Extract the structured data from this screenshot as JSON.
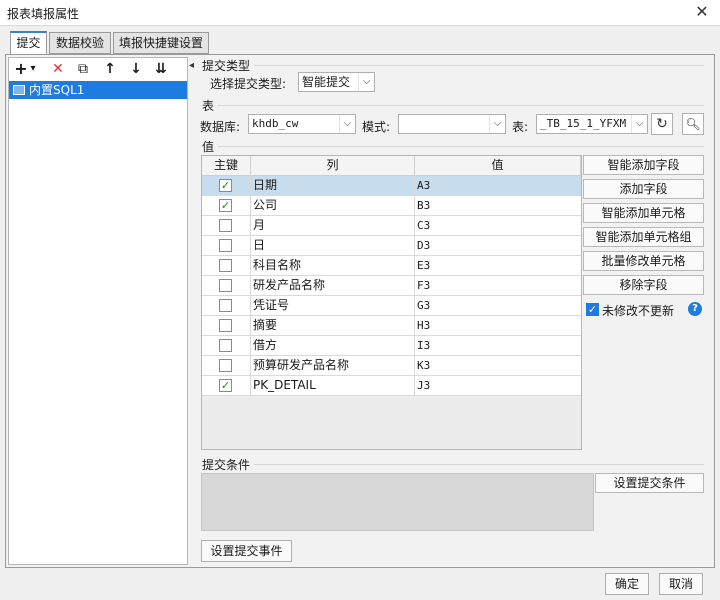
{
  "window": {
    "title": "报表填报属性",
    "close_icon": "close-icon"
  },
  "tabs": [
    {
      "label": "提交",
      "active": true
    },
    {
      "label": "数据校验",
      "active": false
    },
    {
      "label": "填报快捷键设置",
      "active": false
    }
  ],
  "toolbar": {
    "add": "+",
    "add_dropdown": "▾",
    "delete": "✕",
    "copy": "⧉",
    "move_up": "↑",
    "move_down": "↓",
    "sort": "⇊"
  },
  "tree": {
    "items": [
      {
        "label": "内置SQL1",
        "selected": true
      }
    ]
  },
  "submit_type": {
    "section": "提交类型",
    "label": "选择提交类型:",
    "value": "智能提交"
  },
  "table_section": {
    "section": "表",
    "db_label": "数据库:",
    "db_value": "khdb_cw",
    "schema_label": "模式:",
    "schema_value": "",
    "table_label": "表:",
    "table_value": "_TB_15_1_YFXM"
  },
  "value_section": {
    "section": "值",
    "columns": [
      "主键",
      "列",
      "值"
    ],
    "rows": [
      {
        "key": true,
        "col": "日期",
        "val": "A3",
        "selected": true
      },
      {
        "key": true,
        "col": "公司",
        "val": "B3"
      },
      {
        "key": false,
        "col": "月",
        "val": "C3"
      },
      {
        "key": false,
        "col": "日",
        "val": "D3"
      },
      {
        "key": false,
        "col": "科目名称",
        "val": "E3"
      },
      {
        "key": false,
        "col": "研发产品名称",
        "val": "F3"
      },
      {
        "key": false,
        "col": "凭证号",
        "val": "G3"
      },
      {
        "key": false,
        "col": "摘要",
        "val": "H3"
      },
      {
        "key": false,
        "col": "借方",
        "val": "I3"
      },
      {
        "key": false,
        "col": "预算研发产品名称",
        "val": "K3"
      },
      {
        "key": true,
        "col": "PK_DETAIL",
        "val": "J3"
      }
    ],
    "buttons": [
      "智能添加字段",
      "添加字段",
      "智能添加单元格",
      "智能添加单元格组",
      "批量修改单元格",
      "移除字段"
    ],
    "no_update_unmodified": {
      "label": "未修改不更新",
      "checked": true
    }
  },
  "condition": {
    "section": "提交条件",
    "button": "设置提交条件"
  },
  "event_button": "设置提交事件",
  "footer": {
    "ok": "确定",
    "cancel": "取消"
  },
  "colors": {
    "accent": "#1e7be0",
    "selected_row": "#c7dcec",
    "check_green": "#1f8a2a"
  }
}
